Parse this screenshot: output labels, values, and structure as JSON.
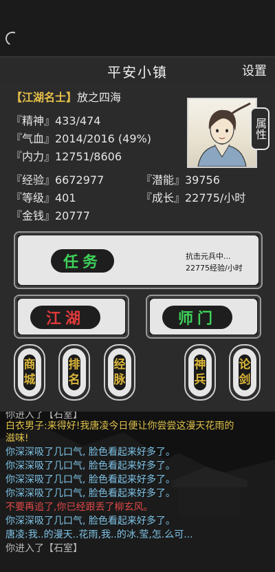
{
  "header": {
    "title": "平安小镇",
    "settings": "设置"
  },
  "player": {
    "rank": "【江湖名士】",
    "name": "放之四海"
  },
  "stats": {
    "jingshen": "『精神』433/474",
    "qixue": "『气血』2014/2016 (49%)",
    "neili": "『内力』12751/8606",
    "jingyan": "『经验』6672977",
    "qianneng": "『潜能』39756",
    "dengji": "『等级』401",
    "chengzhang": "『成长』22775/小时",
    "jinqian": "『金钱』20777"
  },
  "attr_tab": "属性",
  "task": {
    "label": "任务",
    "info_line1": "抗击元兵中...",
    "info_line2": "22775经验/小时"
  },
  "buttons": {
    "jianghu": "江湖",
    "shimen": "师门"
  },
  "side_buttons": [
    "商城",
    "排名",
    "经脉",
    "神兵",
    "论剑"
  ],
  "log": [
    {
      "text": "你进入了【石室】",
      "color": "#b9b9b9"
    },
    {
      "text": "白衣男子:来得好!我唐凌今日便让你尝尝这漫天花雨的",
      "color": "#e0c24a"
    },
    {
      "text": "滋味!",
      "color": "#e0c24a"
    },
    {
      "text": "你深深吸了几口气,  脸色看起来好多了。",
      "color": "#7ec3e6"
    },
    {
      "text": "你深深吸了几口气,  脸色看起来好多了。",
      "color": "#7ec3e6"
    },
    {
      "text": "你深深吸了几口气,  脸色看起来好多了。",
      "color": "#7ec3e6"
    },
    {
      "text": "你深深吸了几口气,  脸色看起来好多了。",
      "color": "#7ec3e6"
    },
    {
      "text": "不要再追了,你已经跟丢了柳玄风。",
      "color": "#e04848"
    },
    {
      "text": "你深深吸了几口气,  脸色看起来好多了。",
      "color": "#7ec3e6"
    },
    {
      "text": "唐凌:我..的漫天..花雨,我..的冰.莹,怎.么可...",
      "color": "#7ec3e6"
    },
    {
      "text": "你进入了【石室】",
      "color": "#b9b9b9"
    }
  ],
  "colors": {
    "green": "#3ed25a",
    "red": "#e23a3a",
    "gold": "#d8b43a"
  }
}
